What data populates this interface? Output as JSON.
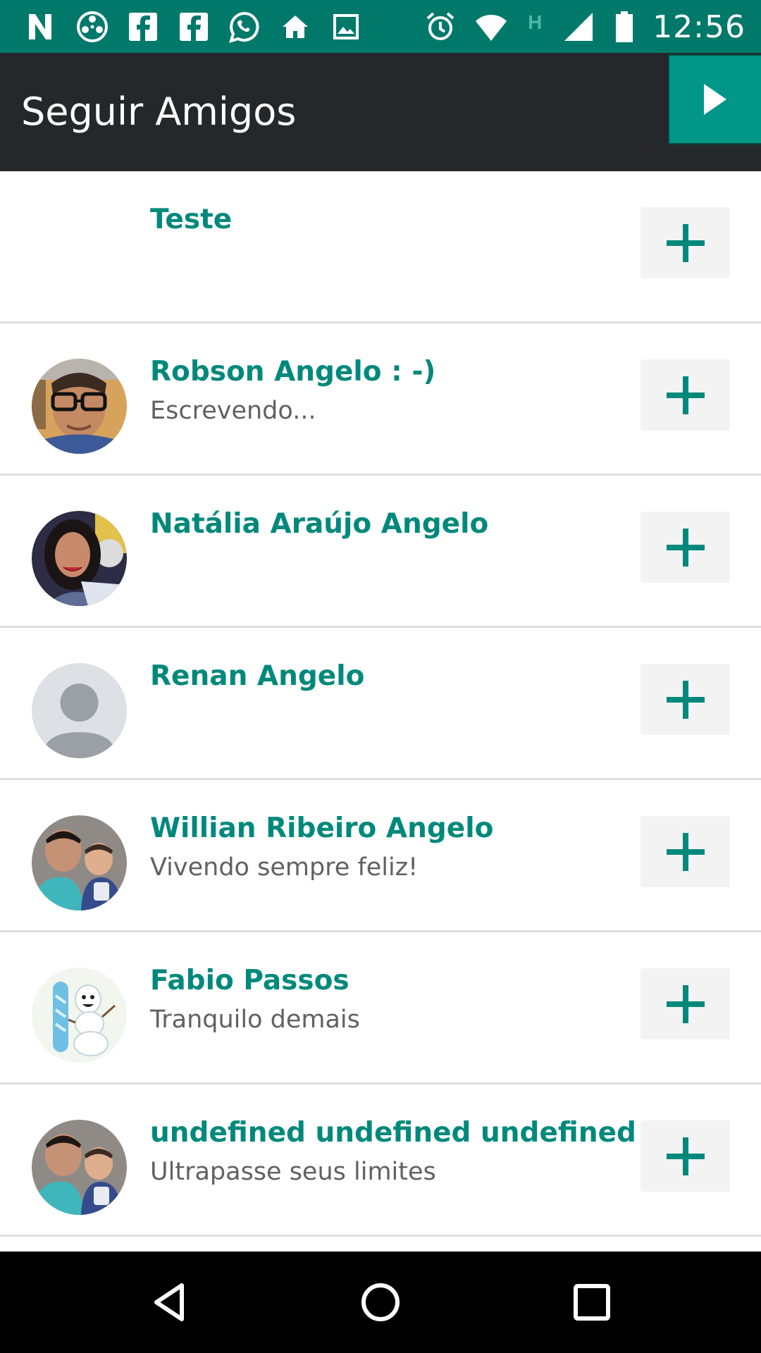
{
  "status_bar": {
    "time": "12:56",
    "network_label": "H",
    "left_icons": [
      "n-icon",
      "film-reel-icon",
      "facebook-icon",
      "facebook-icon",
      "whatsapp-icon",
      "home-icon",
      "image-icon"
    ],
    "right_icons": [
      "alarm-icon",
      "wifi-icon",
      "signal-icon",
      "battery-icon"
    ]
  },
  "app_bar": {
    "title": "Seguir Amigos",
    "next_icon": "play-arrow-icon"
  },
  "friends": [
    {
      "name": "Teste",
      "status": "",
      "avatar": "none"
    },
    {
      "name": "Robson Angelo : -)",
      "status": "Escrevendo...",
      "avatar": "photo"
    },
    {
      "name": "Natália Araújo Angelo",
      "status": "",
      "avatar": "photo"
    },
    {
      "name": "Renan Angelo",
      "status": "",
      "avatar": "default-avatar"
    },
    {
      "name": "Willian Ribeiro Angelo",
      "status": "Vivendo sempre feliz!",
      "avatar": "photo"
    },
    {
      "name": "Fabio Passos",
      "status": "Tranquilo demais",
      "avatar": "cartoon"
    },
    {
      "name": "undefined undefined undefined",
      "status": "Ultrapasse seus limites",
      "avatar": "photo"
    }
  ],
  "colors": {
    "status_bar": "#00796b",
    "app_bar": "#26272b",
    "accent": "#009688",
    "name_text": "#00897b",
    "status_text": "#616161",
    "add_button_bg": "#f3f3f3"
  },
  "nav_bar": {
    "icons": [
      "back-icon",
      "home-circle-icon",
      "recents-icon"
    ]
  }
}
